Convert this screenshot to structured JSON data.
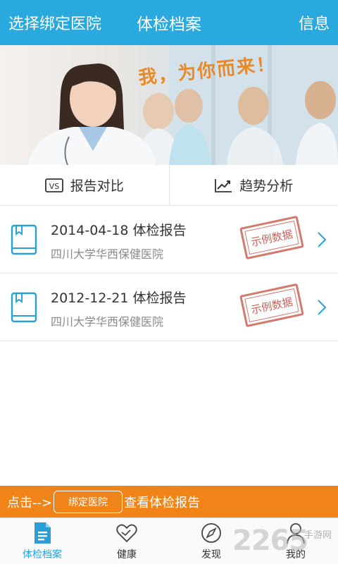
{
  "header": {
    "left_label": "选择绑定医院",
    "title": "体检档案",
    "right_label": "信息"
  },
  "banner": {
    "slogan": "我，为你而来！"
  },
  "actions": [
    {
      "label": "报告对比",
      "icon": "vs-compare-icon"
    },
    {
      "label": "趋势分析",
      "icon": "trend-chart-icon"
    }
  ],
  "reports": [
    {
      "title": "2014-04-18 体检报告",
      "hospital": "四川大学华西保健医院",
      "stamp": "示例数据"
    },
    {
      "title": "2012-12-21 体检报告",
      "hospital": "四川大学华西保健医院",
      "stamp": "示例数据"
    }
  ],
  "bind_bar": {
    "prefix": "点击-->",
    "button_label": "绑定医院",
    "suffix": "查看体检报告"
  },
  "nav": [
    {
      "label": "体检档案",
      "icon": "document-icon",
      "active": true
    },
    {
      "label": "健康",
      "icon": "handshake-heart-icon",
      "active": false
    },
    {
      "label": "发现",
      "icon": "compass-icon",
      "active": false
    },
    {
      "label": "我的",
      "icon": "person-icon",
      "active": false
    }
  ],
  "watermark": {
    "text": "2265",
    "sub": "手游网"
  },
  "colors": {
    "header_bg": "#29a9dd",
    "accent_blue": "#2a9fd6",
    "bind_bar_bg": "#f08419",
    "stamp_red": "#c0392b"
  }
}
